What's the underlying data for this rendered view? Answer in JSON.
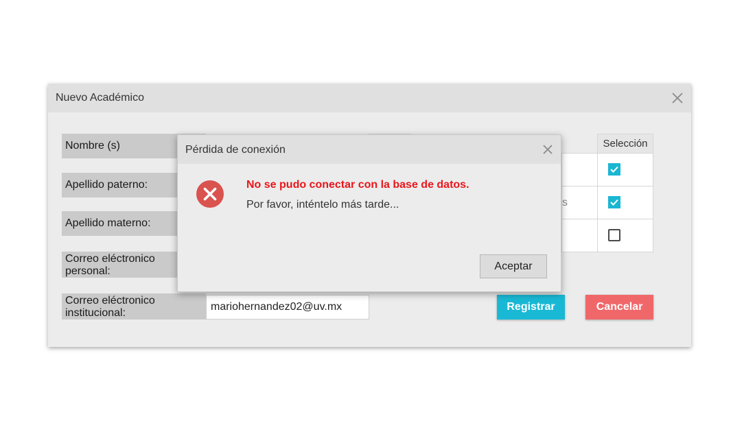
{
  "main_window": {
    "title": "Nuevo Académico",
    "labels": {
      "nombre": "Nombre (s)",
      "apellido_paterno": "Apellido paterno:",
      "apellido_materno": "Apellido materno:",
      "correo_personal_line1": "Correo eléctronico",
      "correo_personal_line2": "personal:",
      "correo_institucional_line1": "Correo eléctronico",
      "correo_institucional_line2": "institucional:"
    },
    "fields": {
      "correo_institucional_value": "mariohernandez02@uv.mx"
    },
    "table": {
      "column_header": "Selección",
      "row_fragment": "s",
      "selections": [
        true,
        true,
        false
      ]
    },
    "buttons": {
      "registrar": "Registrar",
      "cancelar": "Cancelar"
    }
  },
  "dialog": {
    "title": "Pérdida de conexión",
    "error_heading": "No se pudo conectar con la base de datos.",
    "error_message": "Por favor, inténtelo más tarde...",
    "accept_button": "Aceptar"
  },
  "colors": {
    "accent": "#19b9d5",
    "danger": "#f0676a",
    "error_text": "#e8161b",
    "error_icon": "#d9534f"
  },
  "icons": {
    "window_close": "close-icon",
    "dialog_close": "close-icon",
    "dialog_error": "error-icon",
    "checkbox_checked": "checkmark-icon"
  }
}
